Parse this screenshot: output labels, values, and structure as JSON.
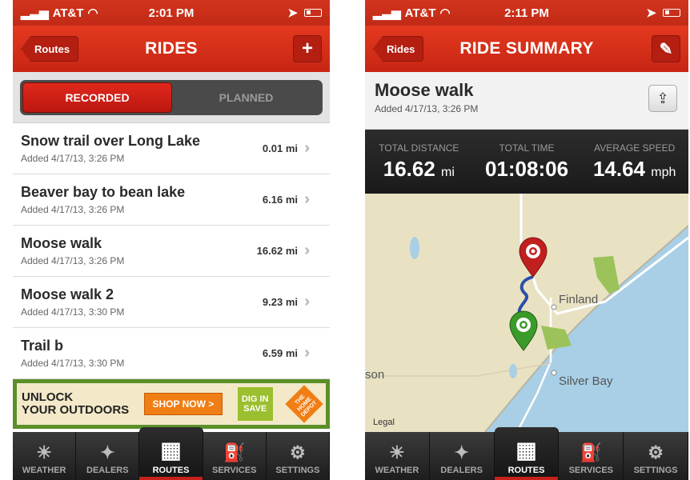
{
  "left": {
    "status": {
      "carrier": "AT&T",
      "time": "2:01 PM"
    },
    "nav": {
      "back": "Routes",
      "title": "RIDES",
      "add": "+"
    },
    "segments": {
      "recorded": "RECORDED",
      "planned": "PLANNED"
    },
    "rides": [
      {
        "name": "Snow trail over Long Lake",
        "date": "Added 4/17/13, 3:26 PM",
        "distance": "0.01 mi"
      },
      {
        "name": "Beaver bay to  bean lake",
        "date": "Added 4/17/13, 3:26 PM",
        "distance": "6.16 mi"
      },
      {
        "name": "Moose walk",
        "date": "Added 4/17/13, 3:26 PM",
        "distance": "16.62 mi"
      },
      {
        "name": "Moose walk 2",
        "date": "Added 4/17/13, 3:30 PM",
        "distance": "9.23 mi"
      },
      {
        "name": "Trail b",
        "date": "Added 4/17/13, 3:30 PM",
        "distance": "6.59 mi"
      }
    ],
    "ad": {
      "line1": "UNLOCK",
      "line2": "YOUR OUTDOORS",
      "cta": "SHOP NOW >",
      "badge": "DIG IN SAVE",
      "logo": "THE HOME DEPOT"
    }
  },
  "right": {
    "status": {
      "carrier": "AT&T",
      "time": "2:11 PM"
    },
    "nav": {
      "back": "Rides",
      "title": "RIDE SUMMARY",
      "edit": "✎"
    },
    "ride": {
      "name": "Moose walk",
      "date": "Added 4/17/13, 3:26 PM"
    },
    "stats": [
      {
        "label": "TOTAL DISTANCE",
        "value": "16.62",
        "unit": "mi"
      },
      {
        "label": "TOTAL TIME",
        "value": "01:08:06",
        "unit": ""
      },
      {
        "label": "AVERAGE SPEED",
        "value": "14.64",
        "unit": "mph"
      }
    ],
    "map": {
      "finland": "Finland",
      "silver_bay": "Silver Bay",
      "son": "son",
      "legal": "Legal"
    }
  },
  "tabs": [
    {
      "label": "WEATHER",
      "icon": "sun-icon"
    },
    {
      "label": "DEALERS",
      "icon": "compass-icon"
    },
    {
      "label": "ROUTES",
      "icon": "map-icon"
    },
    {
      "label": "SERVICES",
      "icon": "fuel-icon"
    },
    {
      "label": "SETTINGS",
      "icon": "gear-icon"
    }
  ],
  "colors": {
    "brand_red": "#d2341d",
    "active_tab": "#c8201a",
    "start_pin": "#3a9a2a",
    "end_pin": "#c0201e",
    "route": "#2a4fa8"
  }
}
